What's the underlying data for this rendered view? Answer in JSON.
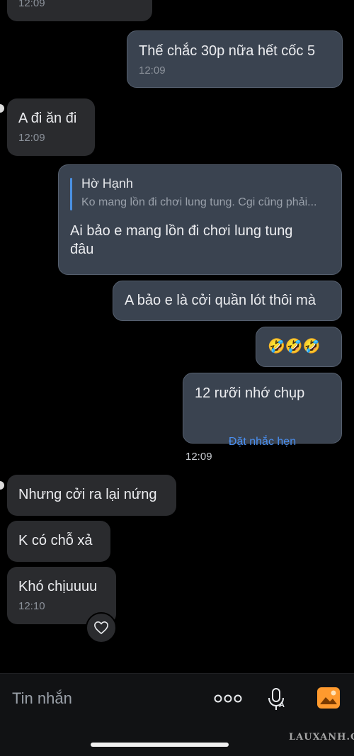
{
  "messages": [
    {
      "id": "m0",
      "time": "12:09"
    },
    {
      "id": "m1",
      "text": "Thế chắc 30p nữa hết cốc 5",
      "time": "12:09"
    },
    {
      "id": "m2",
      "text": "A đi ăn đi",
      "time": "12:09"
    },
    {
      "id": "m3",
      "reply": {
        "name": "Hờ Hạnh",
        "snippet": "Ko mang lồn đi chơi lung tung. Cgi cũng phải..."
      },
      "text_line1": "Ai bảo e mang lồn đi chơi lung tung",
      "text_line2": "đâu"
    },
    {
      "id": "m4",
      "text": "A bảo e là cởi quần lót thôi mà"
    },
    {
      "id": "m5",
      "text": "🤣🤣🤣"
    },
    {
      "id": "m6",
      "text": "12 rưỡi nhớ chụp",
      "action": "Đặt nhắc hẹn"
    },
    {
      "id": "m7",
      "text": "Nhưng cởi ra lại nứng"
    },
    {
      "id": "m8",
      "text": "K có chỗ xả"
    },
    {
      "id": "m9",
      "text": "Khó chịuuuu",
      "time": "12:10"
    }
  ],
  "center_time": "12:09",
  "composer": {
    "placeholder": "Tin nhắn"
  },
  "icons": {
    "more": "more-dots-icon",
    "mic": "microphone-icon",
    "gallery": "gallery-icon",
    "reaction": "heart-icon"
  },
  "colors": {
    "accent": "#4a8ff0",
    "gallery": "#ff9a2e"
  },
  "watermark": "LAUXANH.CC"
}
